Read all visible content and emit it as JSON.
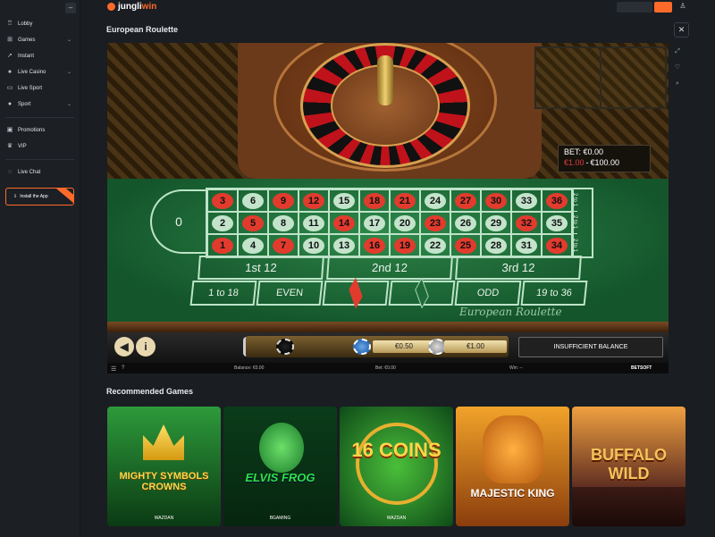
{
  "brand": {
    "logo_prefix": "jungli",
    "logo_suffix": "win",
    "accent": "#ff6a2a"
  },
  "sidebar": {
    "items": [
      {
        "label": "Lobby",
        "icon": "cup-icon"
      },
      {
        "label": "Games",
        "icon": "gamepad-icon",
        "expandable": true
      },
      {
        "label": "Instant",
        "icon": "rocket-icon"
      },
      {
        "label": "Live Casino",
        "icon": "cards-icon",
        "expandable": true
      },
      {
        "label": "Live Sport",
        "icon": "tv-icon"
      },
      {
        "label": "Sport",
        "icon": "ball-icon",
        "expandable": true
      }
    ],
    "secondary": [
      {
        "label": "Promotions",
        "icon": "gift-icon"
      },
      {
        "label": "VIP",
        "icon": "crown-icon"
      }
    ],
    "chat_label": "Live Chat",
    "install_label": "Install the App"
  },
  "game": {
    "title": "European Roulette",
    "bet_label": "BET: €0.00",
    "limit_min": "€1.00",
    "limit_sep": "-",
    "limit_max": "€100.00",
    "zero": "0",
    "columns": [
      "2 to 1",
      "2 to 1",
      "2 to 1"
    ],
    "dozens": [
      "1st 12",
      "2nd 12",
      "3rd 12"
    ],
    "outside": [
      "1 to 18",
      "EVEN",
      "",
      "",
      "ODD",
      "19 to 36"
    ],
    "table_script": "European Roulette",
    "chip_labels": [
      "€0.50",
      "€1.00"
    ],
    "insufficient": "INSUFFICIENT BALANCE",
    "status": {
      "balance": "Balance: €0.00",
      "bet": "Bet: €0.00",
      "win": "Win: --",
      "provider": "BETSOFT"
    },
    "rows": [
      [
        3,
        6,
        9,
        12,
        15,
        18,
        21,
        24,
        27,
        30,
        33,
        36
      ],
      [
        2,
        5,
        8,
        11,
        14,
        17,
        20,
        23,
        26,
        29,
        32,
        35
      ],
      [
        1,
        4,
        7,
        10,
        13,
        16,
        19,
        22,
        25,
        28,
        31,
        34
      ]
    ],
    "red_numbers": [
      1,
      3,
      5,
      7,
      9,
      12,
      14,
      16,
      18,
      19,
      21,
      23,
      25,
      27,
      30,
      32,
      34,
      36
    ]
  },
  "recommended": {
    "title": "Recommended Games",
    "games": [
      {
        "name": "MIGHTY SYMBOLS CROWNS",
        "provider": "WAZDAN"
      },
      {
        "name": "ELVIS FROG",
        "provider": "BGAMING"
      },
      {
        "name": "16 COINS",
        "provider": "WAZDAN"
      },
      {
        "name": "MAJESTIC KING",
        "provider": ""
      },
      {
        "name": "BUFFALO WILD",
        "provider": ""
      }
    ]
  }
}
